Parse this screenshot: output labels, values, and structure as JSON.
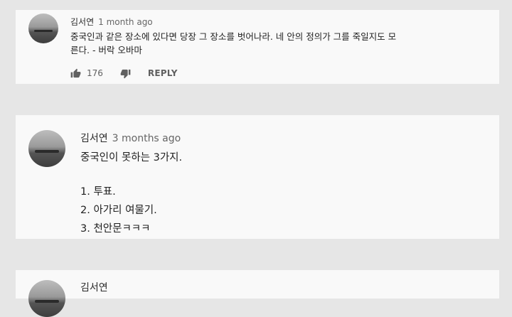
{
  "comments": [
    {
      "author": "김서연",
      "time": "1 month ago",
      "lines": [
        "중국인과 같은 장소에 있다면 당장 그 장소를 벗어나라. 네 안의 정의가 그를 죽일지도 모",
        "른다. - 버락 오바마"
      ],
      "likes": "176",
      "reply_label": "REPLY"
    },
    {
      "author": "김서연",
      "time": "3 months ago",
      "lines": [
        "중국인이 못하는 3가지.",
        "1. 투표.",
        "2. 아가리 여물기.",
        "3. 천안문ㅋㅋㅋ"
      ]
    },
    {
      "author": "김서연"
    }
  ]
}
